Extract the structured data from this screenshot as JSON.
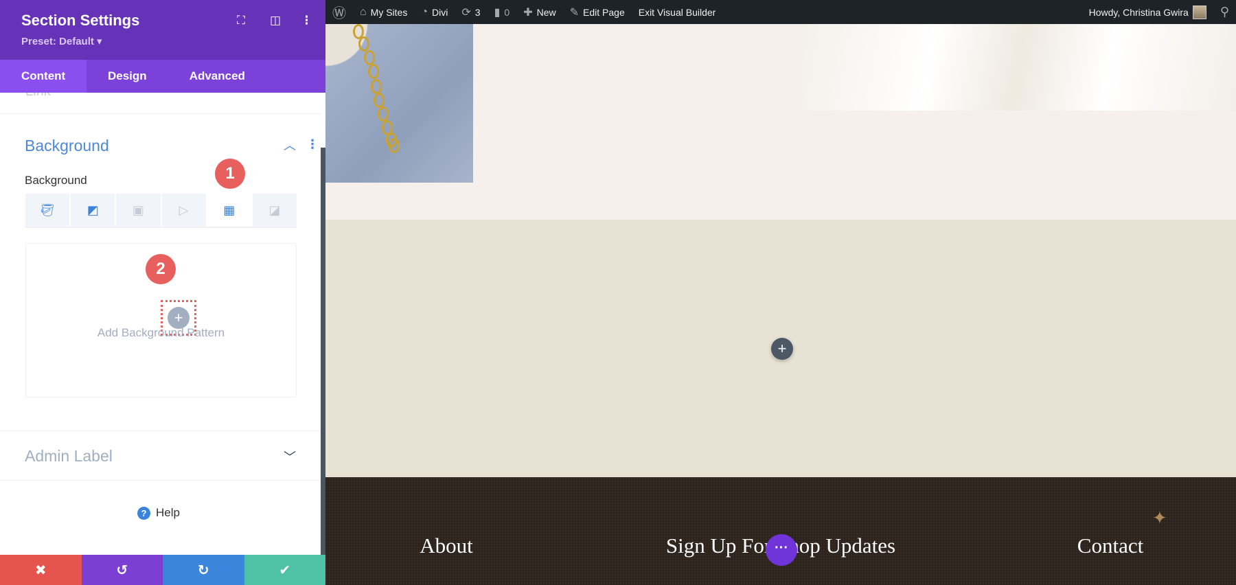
{
  "panel": {
    "title": "Section Settings",
    "preset": "Preset: Default ▾",
    "header_icons": [
      "focus-icon",
      "split-view-icon",
      "kebab-icon"
    ],
    "tabs": [
      {
        "label": "Content",
        "active": true
      },
      {
        "label": "Design"
      },
      {
        "label": "Advanced"
      }
    ],
    "collapsed_above": "Link",
    "background_section": {
      "title": "Background",
      "field_label": "Background",
      "types": [
        "color",
        "gradient",
        "image",
        "video",
        "pattern",
        "mask"
      ],
      "active_type": "pattern",
      "add_pattern_label": "Add Background Pattern"
    },
    "admin_label": "Admin Label",
    "help": "Help",
    "annotations": [
      "1",
      "2"
    ],
    "bottom_buttons": [
      {
        "name": "discard",
        "glyph": "✖",
        "color": "#e5544e"
      },
      {
        "name": "undo",
        "glyph": "↺",
        "color": "#7b3fd4"
      },
      {
        "name": "redo",
        "glyph": "↻",
        "color": "#3b86dc"
      },
      {
        "name": "save",
        "glyph": "✔",
        "color": "#4fc2a6"
      }
    ]
  },
  "adminbar": {
    "my_sites": "My Sites",
    "divi": "Divi",
    "updates": "3",
    "comments": "0",
    "new": "New",
    "edit_page": "Edit Page",
    "exit": "Exit Visual Builder",
    "howdy": "Howdy, Christina Gwira"
  },
  "footer": {
    "about": "About",
    "signup": "Sign Up For Shop Updates",
    "contact": "Contact"
  }
}
